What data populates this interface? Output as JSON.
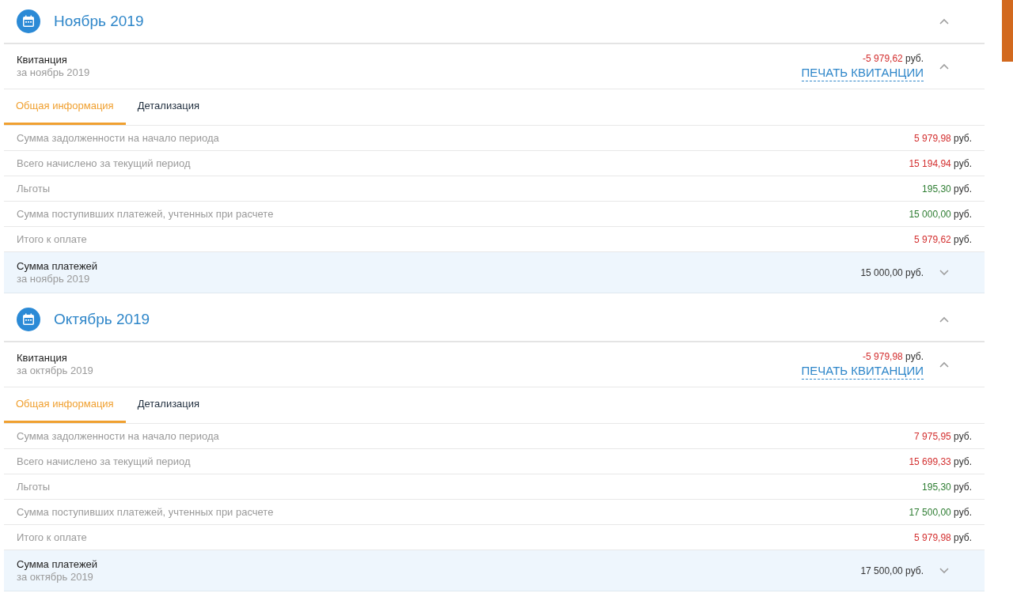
{
  "sections": [
    {
      "title": "Ноябрь 2019",
      "expanded": true,
      "receipt": {
        "title": "Квитанция",
        "subtitle": "за ноябрь 2019",
        "amount": "-5 979,62",
        "currency": "руб.",
        "print_link": "ПЕЧАТЬ КВИТАНЦИИ",
        "expanded": true
      },
      "tabs": [
        {
          "label": "Общая информация",
          "selected": true
        },
        {
          "label": "Детализация",
          "selected": false
        }
      ],
      "rows": [
        {
          "label": "Сумма задолженности на начало периода",
          "amount": "5 979,98",
          "currency": "руб.",
          "kind": "debit"
        },
        {
          "label": "Всего начислено за текущий период",
          "amount": "15 194,94",
          "currency": "руб.",
          "kind": "debit"
        },
        {
          "label": "Льготы",
          "amount": "195,30",
          "currency": "руб.",
          "kind": "credit"
        },
        {
          "label": "Сумма поступивших платежей, учтенных при расчете",
          "amount": "15 000,00",
          "currency": "руб.",
          "kind": "credit"
        },
        {
          "label": "Итого к оплате",
          "amount": "5 979,62",
          "currency": "руб.",
          "kind": "debit"
        }
      ],
      "payments": {
        "title": "Сумма платежей",
        "subtitle": "за ноябрь 2019",
        "amount": "15 000,00 руб.",
        "expanded": false
      }
    },
    {
      "title": "Октябрь 2019",
      "expanded": true,
      "receipt": {
        "title": "Квитанция",
        "subtitle": "за октябрь 2019",
        "amount": "-5 979,98",
        "currency": "руб.",
        "print_link": "ПЕЧАТЬ КВИТАНЦИИ",
        "expanded": true
      },
      "tabs": [
        {
          "label": "Общая информация",
          "selected": true
        },
        {
          "label": "Детализация",
          "selected": false
        }
      ],
      "rows": [
        {
          "label": "Сумма задолженности на начало периода",
          "amount": "7 975,95",
          "currency": "руб.",
          "kind": "debit"
        },
        {
          "label": "Всего начислено за текущий период",
          "amount": "15 699,33",
          "currency": "руб.",
          "kind": "debit"
        },
        {
          "label": "Льготы",
          "amount": "195,30",
          "currency": "руб.",
          "kind": "credit"
        },
        {
          "label": "Сумма поступивших платежей, учтенных при расчете",
          "amount": "17 500,00",
          "currency": "руб.",
          "kind": "credit"
        },
        {
          "label": "Итого к оплате",
          "amount": "5 979,98",
          "currency": "руб.",
          "kind": "debit"
        }
      ],
      "payments": {
        "title": "Сумма платежей",
        "subtitle": "за октябрь 2019",
        "amount": "17 500,00 руб.",
        "expanded": false
      }
    }
  ]
}
